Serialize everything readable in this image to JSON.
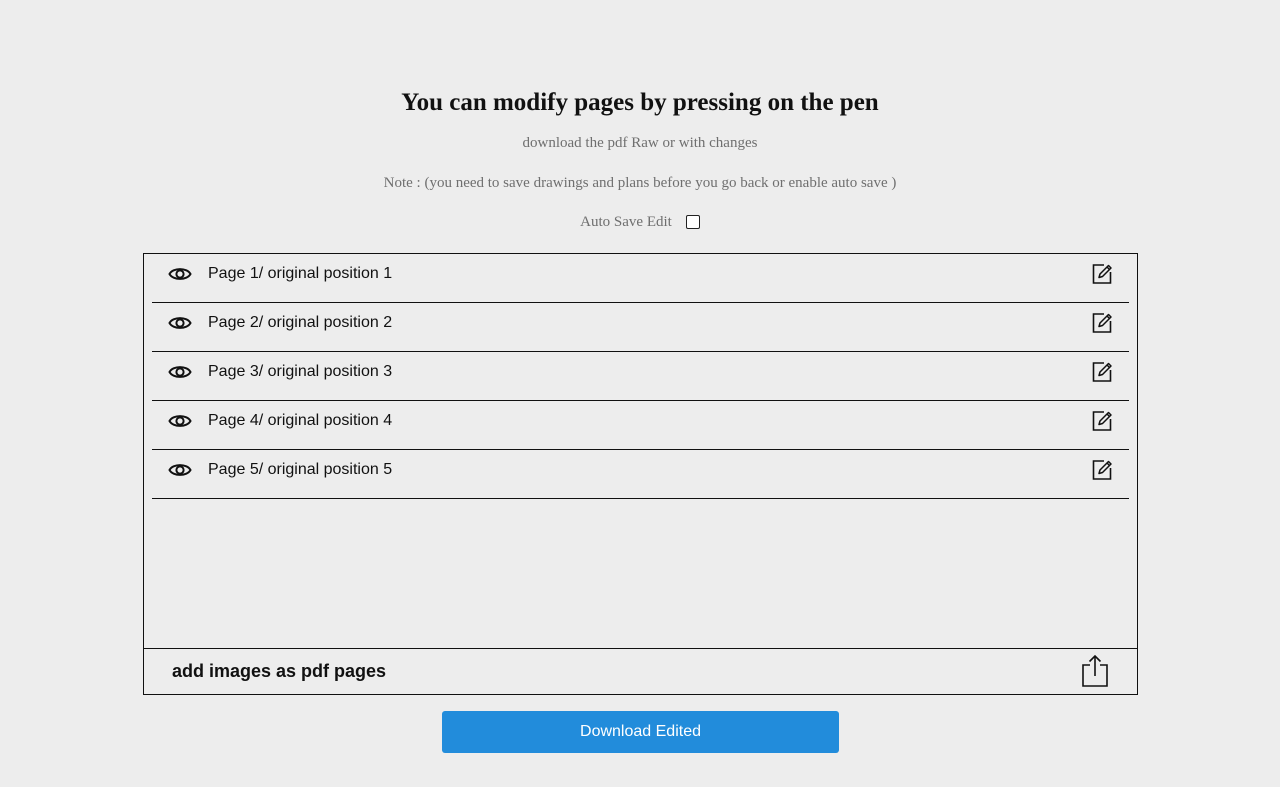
{
  "header": {
    "title": "You can modify pages by pressing on the pen",
    "subtitle": "download the pdf Raw or with changes",
    "note": "Note : (you need to save drawings and plans before you go back or enable auto save )",
    "auto_save_label": "Auto Save Edit",
    "auto_save_checked": false
  },
  "pages": [
    {
      "label": "Page 1/ original position 1",
      "view_icon": "eye-icon",
      "edit_icon": "edit-icon"
    },
    {
      "label": "Page 2/ original position 2",
      "view_icon": "eye-icon",
      "edit_icon": "edit-icon"
    },
    {
      "label": "Page 3/ original position 3",
      "view_icon": "eye-icon",
      "edit_icon": "edit-icon"
    },
    {
      "label": "Page 4/ original position 4",
      "view_icon": "eye-icon",
      "edit_icon": "edit-icon"
    },
    {
      "label": "Page 5/ original position 5",
      "view_icon": "eye-icon",
      "edit_icon": "edit-icon"
    }
  ],
  "footer": {
    "add_images_label": "add images as pdf pages",
    "upload_icon": "share-icon"
  },
  "download_button": {
    "label": "Download Edited",
    "color": "#228cdb"
  }
}
